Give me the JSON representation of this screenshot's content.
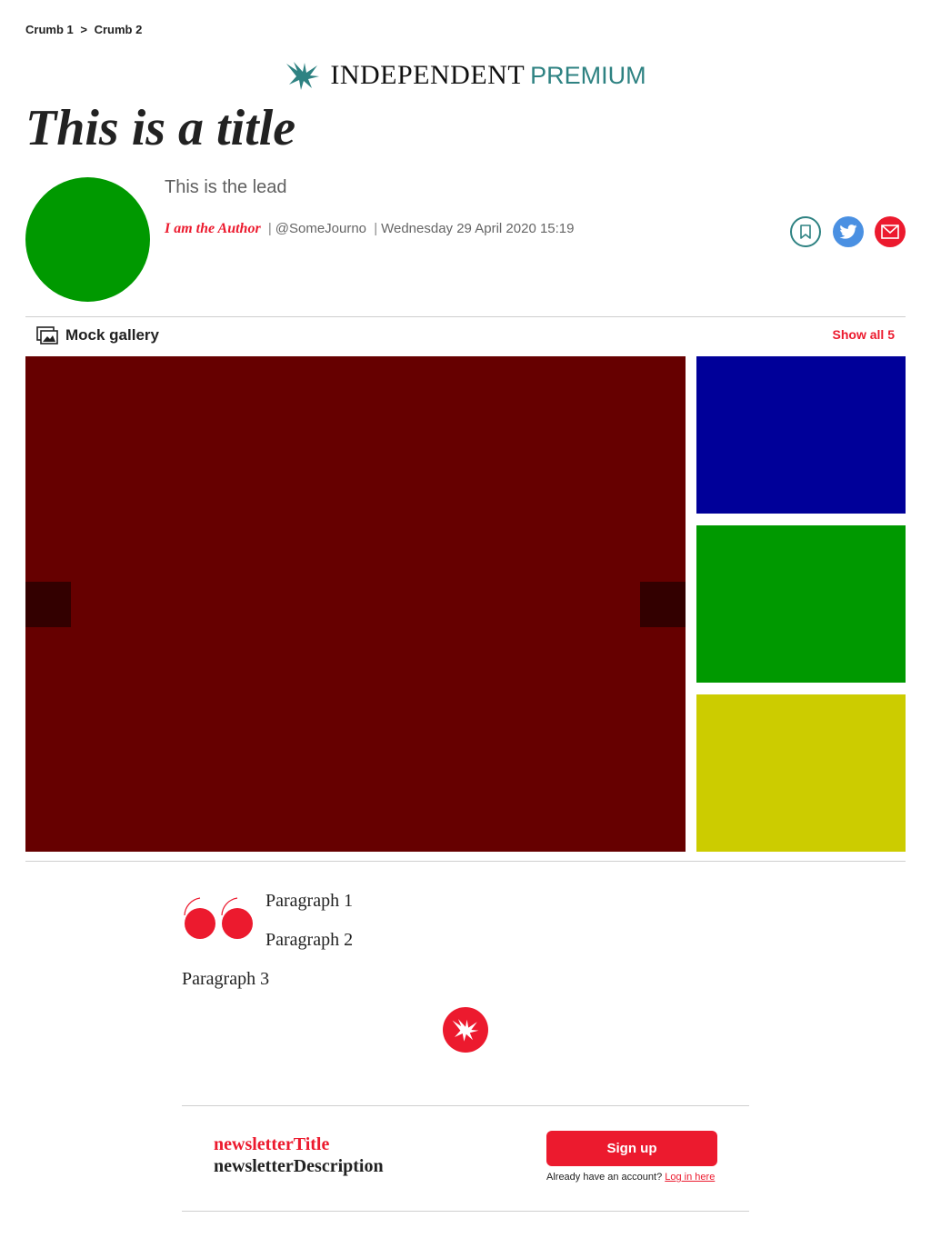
{
  "breadcrumb": {
    "items": [
      "Crumb 1",
      "Crumb 2"
    ],
    "separator": ">"
  },
  "masthead": {
    "wordmark": "INDEPENDENT",
    "premium": "PREMIUM",
    "premium_color": "#2e8282",
    "icon": "eagle-icon"
  },
  "article": {
    "title": "This is a title",
    "lead": "This is the lead",
    "author": "I am the Author",
    "handle": "@SomeJourno",
    "date": "Wednesday 29 April 2020 15:19",
    "avatar_color": "#009900"
  },
  "share": {
    "icons": [
      "bookmark-icon",
      "twitter-icon",
      "email-icon"
    ],
    "twitter_color": "#4a90e2",
    "email_color": "#ec1a2e"
  },
  "gallery": {
    "title": "Mock gallery",
    "show_all": "Show all 5",
    "main_color": "#660000",
    "thumb_colors": [
      "#000099",
      "#009900",
      "#cccc00"
    ]
  },
  "body": {
    "paragraphs": [
      "Paragraph 1",
      "Paragraph 2",
      "Paragraph 3"
    ],
    "quote_icon": "quote-icon"
  },
  "newsletter": {
    "title": "newsletterTitle",
    "description": "newsletterDescription",
    "signup_label": "Sign up",
    "account_text": "Already have an account?",
    "login_label": "Log in here"
  },
  "colors": {
    "accent": "#ec1a2e",
    "text": "#222222"
  }
}
